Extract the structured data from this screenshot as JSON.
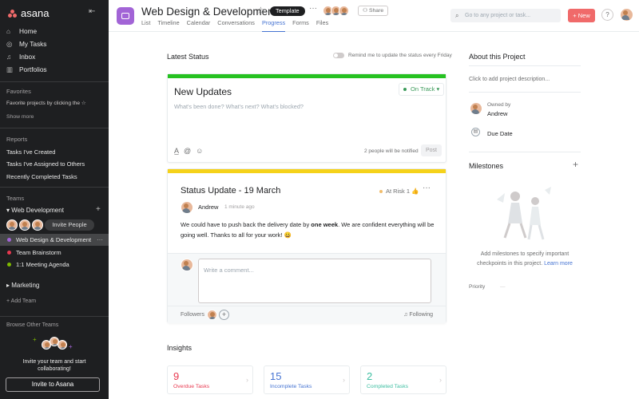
{
  "sidebar": {
    "brand": "asana",
    "nav": [
      {
        "label": "Home",
        "icon": "home-icon"
      },
      {
        "label": "My Tasks",
        "icon": "check-circle-icon"
      },
      {
        "label": "Inbox",
        "icon": "bell-icon"
      },
      {
        "label": "Portfolios",
        "icon": "chart-icon"
      }
    ],
    "favorites_header": "Favorites",
    "favorites_hint": "Favorite projects by clicking the",
    "show_more": "Show more",
    "reports_header": "Reports",
    "reports": [
      "Tasks I've Created",
      "Tasks I've Assigned to Others",
      "Recently Completed Tasks"
    ],
    "teams_header": "Teams",
    "team_name": "Web Development",
    "invite_people": "Invite People",
    "projects": [
      {
        "label": "Web Design & Development",
        "color": "#a264d6"
      },
      {
        "label": "Team Brainstorm",
        "color": "#e8384f"
      },
      {
        "label": "1:1 Meeting Agenda",
        "color": "#7fba00"
      }
    ],
    "marketing": "Marketing",
    "add_team": "Add Team",
    "browse_teams": "Browse Other Teams",
    "invite_text_1": "Invite your team and start",
    "invite_text_2": "collaborating!",
    "invite_button": "Invite to Asana"
  },
  "header": {
    "title": "Web Design & Development",
    "template_badge": "Template",
    "share": "Share",
    "tabs": [
      "List",
      "Timeline",
      "Calendar",
      "Conversations",
      "Progress",
      "Forms",
      "Files"
    ],
    "active_tab": "Progress",
    "search_placeholder": "Go to any project or task...",
    "new_button": "New",
    "help": "?"
  },
  "main": {
    "latest_status": "Latest Status",
    "remind_toggle": "Remind me to update the status every Friday",
    "new_update": {
      "title": "New Updates",
      "placeholder": "What's been done? What's next? What's blocked?",
      "status": "On Track",
      "notified": "2 people will be notified",
      "post": "Post"
    },
    "status_update": {
      "title": "Status Update - 19 March",
      "status": "At Risk",
      "likes": "1",
      "author": "Andrew",
      "time": "1 minute ago",
      "body_1": "We could have to push back the delivery date by ",
      "body_bold": "one week",
      "body_2": ". We are confident everything will be",
      "body_3": "going well. Thanks to all for your work! 😀",
      "comment_placeholder": "Write a comment...",
      "followers": "Followers",
      "following": "Following"
    },
    "insights_title": "Insights",
    "insights": [
      {
        "value": "9",
        "label": "Overdue Tasks",
        "color": "#e8384f"
      },
      {
        "value": "15",
        "label": "Incomplete Tasks",
        "color": "#4573d2"
      },
      {
        "value": "2",
        "label": "Completed Tasks",
        "color": "#3bbea1"
      }
    ]
  },
  "about": {
    "title": "About this Project",
    "description_placeholder": "Click to add project description...",
    "owned_by_label": "Owned by",
    "owner": "Andrew",
    "due_date": "Due Date",
    "milestones_title": "Milestones",
    "milestones_text_1": "Add milestones to specify important",
    "milestones_text_2": "checkpoints in this project.",
    "learn_more": "Learn more",
    "priority_label": "Priority",
    "priority_value": "—"
  }
}
